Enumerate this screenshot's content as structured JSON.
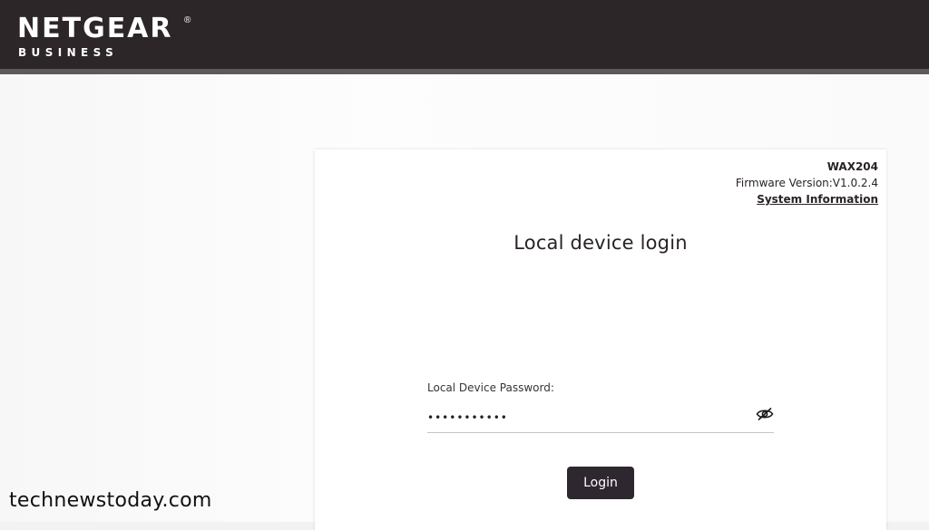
{
  "brand": {
    "name": "NETGEAR",
    "registered": "®",
    "subtitle": "BUSINESS"
  },
  "device": {
    "model": "WAX204",
    "firmware": "Firmware Version:V1.0.2.4",
    "system_info_link": "System Information"
  },
  "login": {
    "title": "Local device login",
    "password_label": "Local Device Password:",
    "password_value": "•••••••••••",
    "button_label": "Login",
    "eye_icon": "eye-hidden-icon"
  },
  "watermark": "technewstoday.com",
  "colors": {
    "topbar": "#2d2629",
    "button": "#2f2730",
    "text": "#2a2326"
  }
}
